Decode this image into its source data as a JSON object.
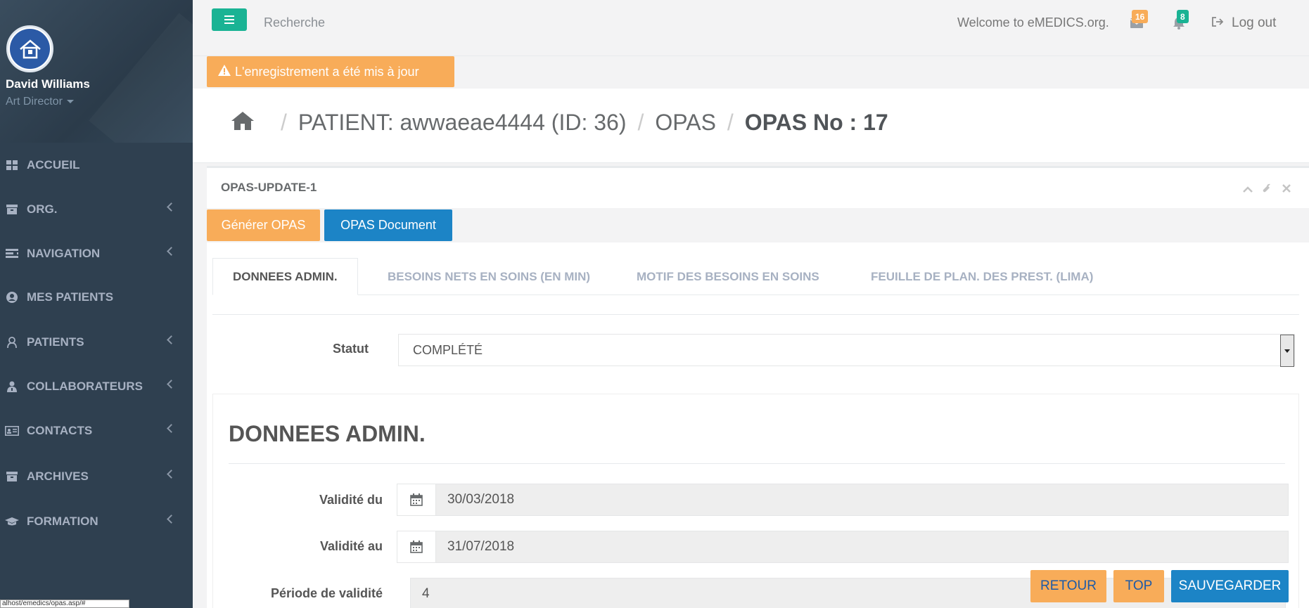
{
  "sidebar": {
    "profile": {
      "name": "David Williams",
      "role": "Art Director"
    },
    "items": [
      {
        "label": "ACCUEIL",
        "icon": "th-large-icon",
        "has_children": false
      },
      {
        "label": "ORG.",
        "icon": "archive-icon",
        "has_children": true
      },
      {
        "label": "NAVIGATION",
        "icon": "tasks-icon",
        "has_children": true
      },
      {
        "label": "MES PATIENTS",
        "icon": "user-circle-icon",
        "has_children": false
      },
      {
        "label": "PATIENTS",
        "icon": "user-icon",
        "has_children": true
      },
      {
        "label": "COLLABORATEURS",
        "icon": "user-md-icon",
        "has_children": true
      },
      {
        "label": "CONTACTS",
        "icon": "address-card-icon",
        "has_children": true
      },
      {
        "label": "ARCHIVES",
        "icon": "archive-icon",
        "has_children": true
      },
      {
        "label": "FORMATION",
        "icon": "graduation-cap-icon",
        "has_children": true
      }
    ],
    "status_url": "alhost/emedics/opas.asp/#"
  },
  "topbar": {
    "search_placeholder": "Recherche",
    "welcome": "Welcome to eMEDICS.org.",
    "messages_count": "16",
    "notifications_count": "8",
    "logout_label": "Log out"
  },
  "alert": {
    "text": "L'enregistrement a été mis à jour"
  },
  "breadcrumb": {
    "patient": "PATIENT: awwaeae4444 (ID: 36)",
    "section": "OPAS",
    "current": "OPAS No : 17"
  },
  "panel": {
    "title": "OPAS-UPDATE-1",
    "generate_button": "Générer OPAS",
    "document_button": "OPAS Document"
  },
  "tabs": [
    {
      "label": "DONNEES ADMIN.",
      "active": true
    },
    {
      "label": "BESOINS NETS EN SOINS (EN MIN)",
      "active": false
    },
    {
      "label": "MOTIF DES BESOINS EN SOINS",
      "active": false
    },
    {
      "label": "FEUILLE DE PLAN. DES PREST. (LIMA)",
      "active": false
    }
  ],
  "form": {
    "status_label": "Statut",
    "status_value": "COMPLÉTÉ",
    "section_title": "DONNEES ADMIN.",
    "valid_from_label": "Validité du",
    "valid_from_value": "30/03/2018",
    "valid_to_label": "Validité au",
    "valid_to_value": "31/07/2018",
    "period_label": "Période de validité",
    "period_value": "4"
  },
  "actions": {
    "back": "RETOUR",
    "top": "TOP",
    "save": "SAUVEGARDER"
  },
  "colors": {
    "sidebar_bg": "#2f4050",
    "primary": "#1ab394",
    "warning": "#f8ac59",
    "info": "#1c84c6"
  }
}
